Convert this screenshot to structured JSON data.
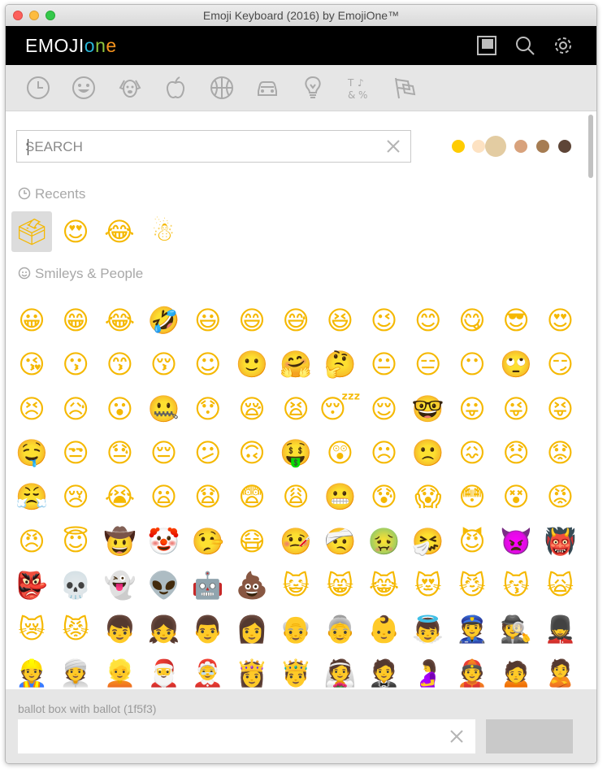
{
  "window": {
    "title": "Emoji Keyboard (2016) by EmojiOne™"
  },
  "appbar": {
    "logo_prefix": "EMOJI",
    "logo_o": "o",
    "logo_n": "n",
    "logo_e": "e",
    "icons": [
      "window-icon",
      "search-icon",
      "gear-icon"
    ]
  },
  "categories": [
    {
      "name": "recents",
      "icon": "clock-icon"
    },
    {
      "name": "smileys",
      "icon": "smiley-icon"
    },
    {
      "name": "animals",
      "icon": "dog-icon"
    },
    {
      "name": "food",
      "icon": "apple-icon"
    },
    {
      "name": "activity",
      "icon": "basketball-icon"
    },
    {
      "name": "travel",
      "icon": "car-icon"
    },
    {
      "name": "objects",
      "icon": "lightbulb-icon"
    },
    {
      "name": "symbols",
      "icon": "symbols-icon"
    },
    {
      "name": "flags",
      "icon": "flag-icon"
    }
  ],
  "search": {
    "placeholder": "SEARCH",
    "value": ""
  },
  "skin_tones": [
    "#ffcc00",
    "#fde2c2",
    "#e3cca2",
    "#d8a27c",
    "#a67c52",
    "#5e4537"
  ],
  "sections": {
    "recents_label": "Recents",
    "smileys_label": "Smileys & People"
  },
  "recents": [
    "🗳",
    "😍",
    "😂",
    "☃"
  ],
  "smileys": [
    [
      "😀",
      "😁",
      "😂",
      "🤣",
      "😃",
      "😄",
      "😅",
      "😆",
      "😉",
      "😊",
      "😋",
      "😎",
      "😍"
    ],
    [
      "😘",
      "😗",
      "😙",
      "😚",
      "☺",
      "🙂",
      "🤗",
      "🤔",
      "😐",
      "😑",
      "😶",
      "🙄",
      "😏"
    ],
    [
      "😣",
      "😥",
      "😮",
      "🤐",
      "😯",
      "😪",
      "😫",
      "😴",
      "😌",
      "🤓",
      "😛",
      "😜",
      "😝"
    ],
    [
      "🤤",
      "😒",
      "😓",
      "😔",
      "😕",
      "🙃",
      "🤑",
      "😲",
      "☹",
      "🙁",
      "😖",
      "😞",
      "😟"
    ],
    [
      "😤",
      "😢",
      "😭",
      "😦",
      "😧",
      "😨",
      "😩",
      "😬",
      "😰",
      "😱",
      "😳",
      "😵",
      "😡"
    ],
    [
      "😠",
      "😇",
      "🤠",
      "🤡",
      "🤥",
      "😷",
      "🤒",
      "🤕",
      "🤢",
      "🤧",
      "😈",
      "👿",
      "👹"
    ],
    [
      "👺",
      "💀",
      "👻",
      "👽",
      "🤖",
      "💩",
      "😺",
      "😸",
      "😹",
      "😻",
      "😼",
      "😽",
      "🙀"
    ],
    [
      "😿",
      "😾",
      "👦",
      "👧",
      "👨",
      "👩",
      "👴",
      "👵",
      "👶",
      "👼",
      "👮",
      "🕵",
      "💂"
    ],
    [
      "👷",
      "👳",
      "👱",
      "🎅",
      "🤶",
      "👸",
      "🤴",
      "👰",
      "🤵",
      "🤰",
      "👲",
      "🙍",
      "🙎"
    ]
  ],
  "footer": {
    "selected_label": "ballot box with ballot (1f5f3)",
    "input_value": ""
  }
}
